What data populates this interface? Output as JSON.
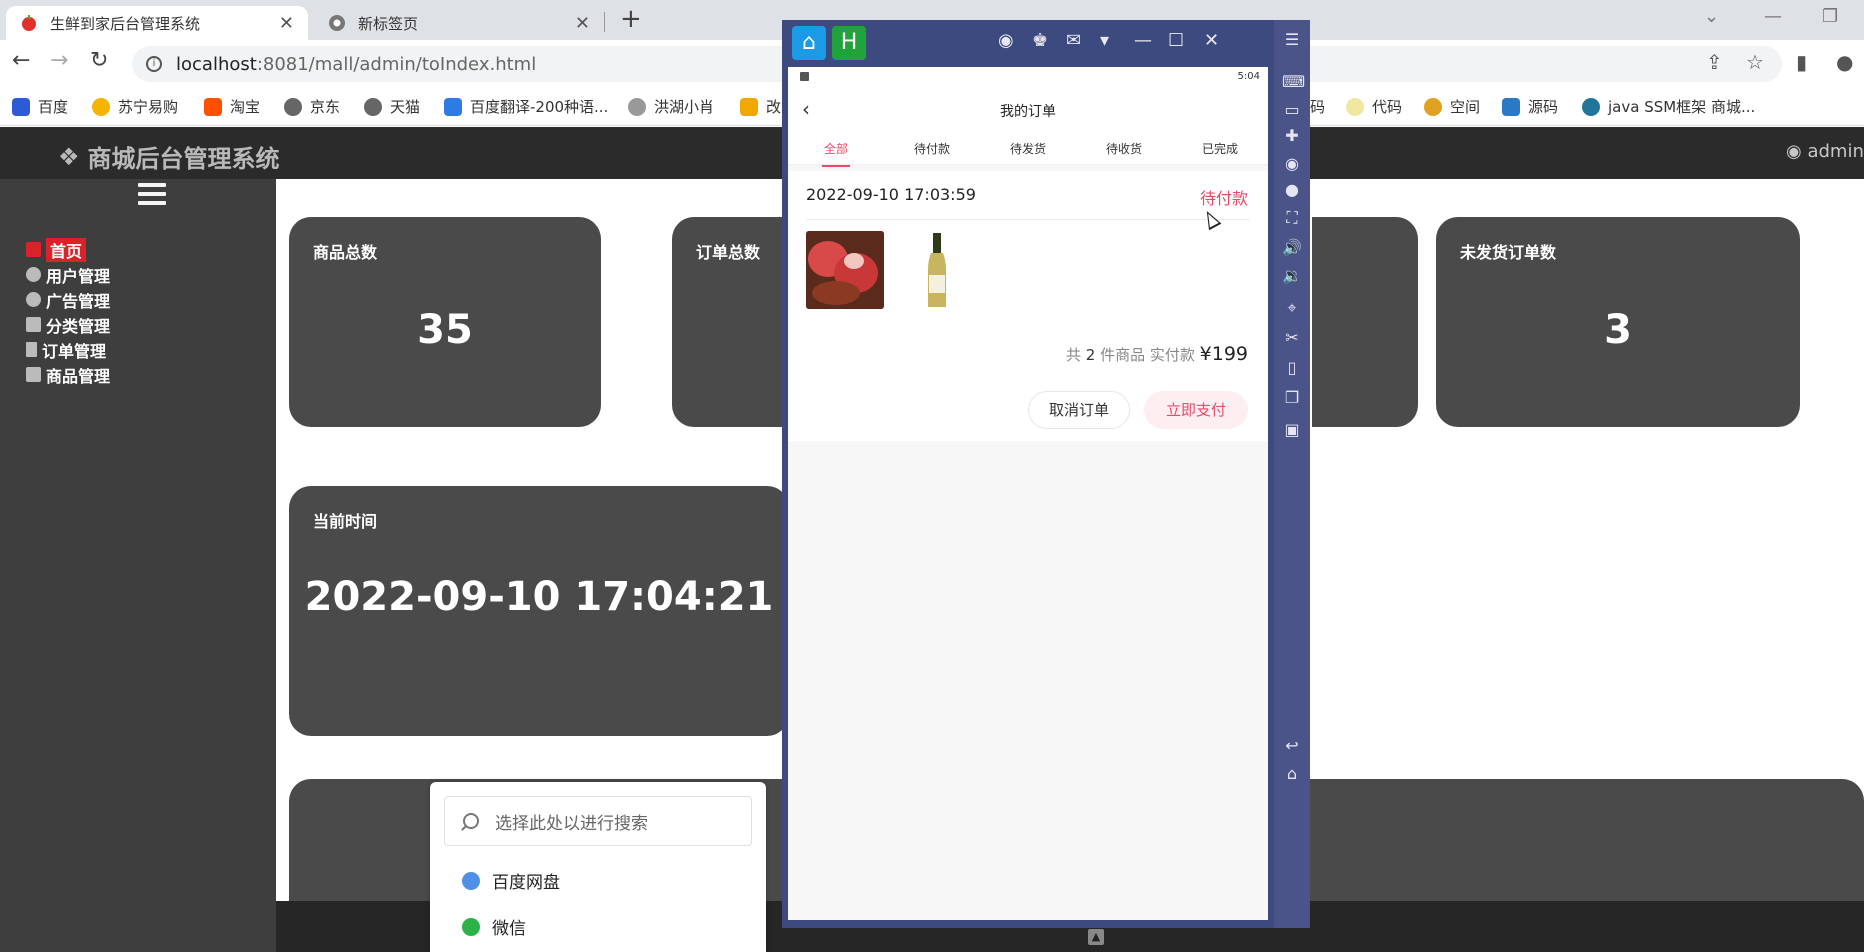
{
  "browser": {
    "tabs": [
      {
        "title": "生鲜到家后台管理系统",
        "close": "✕"
      },
      {
        "title": "新标签页",
        "close": "✕"
      }
    ],
    "new_tab": "+",
    "url_host": "localhost",
    "url_rest": ":8081/mall/admin/toIndex.html",
    "bookmarks": [
      "百度",
      "苏宁易购",
      "淘宝",
      "京东",
      "天猫",
      "百度翻译-200种语...",
      "洪湖小肖",
      "改",
      "码",
      "代码",
      "空间",
      "源码",
      "java SSM框架 商城..."
    ]
  },
  "admin": {
    "brand": "商城后台管理系统",
    "user": "admin",
    "menu": [
      "首页",
      "用户管理",
      "广告管理",
      "分类管理",
      "订单管理",
      "商品管理"
    ],
    "cards": {
      "products_title": "商品总数",
      "products_value": "35",
      "orders_title": "订单总数",
      "unshipped_title": "未发货订单数",
      "unshipped_value": "3",
      "time_title": "当前时间",
      "time_value": "2022-09-10 17:04:21"
    }
  },
  "start_popup": {
    "search_placeholder": "选择此处以进行搜索",
    "items": [
      "百度网盘",
      "微信"
    ]
  },
  "phone": {
    "status_time": "5:04",
    "title": "我的订单",
    "tabs": [
      "全部",
      "待付款",
      "待发货",
      "待收货",
      "已完成"
    ],
    "order": {
      "date": "2022-09-10 17:03:59",
      "status": "待付款",
      "summary_prefix": "共",
      "count": "2",
      "summary_mid": "件商品 实付款",
      "currency": "¥",
      "price": "199",
      "cancel_label": "取消订单",
      "pay_label": "立即支付"
    }
  },
  "colors": {
    "accent_pink": "#e84a6a",
    "card_gray": "#4a4a4a",
    "sidebar": "#3e3e3e",
    "emulator": "#3c4a80",
    "menu_active": "#d9222a"
  }
}
